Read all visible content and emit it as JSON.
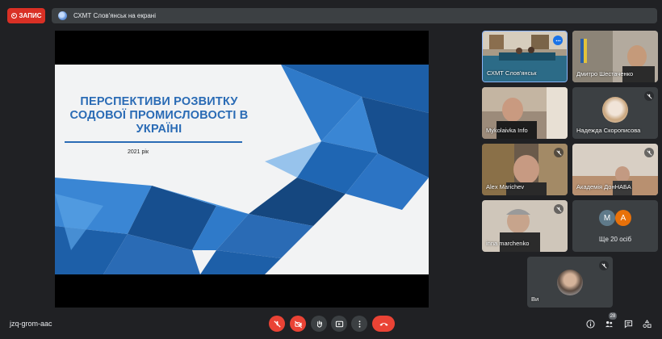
{
  "recording": {
    "label": "ЗАПИС"
  },
  "pinned": {
    "name": "СХМТ Слов'янськ на екрані"
  },
  "slide": {
    "title_line1": "ПЕРСПЕКТИВИ РОЗВИТКУ",
    "title_line2": "СОДОВОЇ ПРОМИСЛОВОСТІ В",
    "title_line3": "УКРАЇНІ",
    "year": "2021 рік",
    "accent_color": "#2a6bb5"
  },
  "participants": [
    {
      "name": "СХМТ Слов'янськ",
      "muted": false,
      "icon": "more-options-icon"
    },
    {
      "name": "Дмитро Шестаченко",
      "muted": false
    },
    {
      "name": "Mykolaivka Info",
      "muted": false
    },
    {
      "name": "Надежда Скорописова",
      "muted": true,
      "icon": "mic-off-icon"
    },
    {
      "name": "Alex Marichev",
      "muted": true,
      "icon": "mic-off-icon"
    },
    {
      "name": "Академія ДонНАБА",
      "muted": true,
      "icon": "mic-off-icon"
    },
    {
      "name": "inna marchenko",
      "muted": true,
      "icon": "mic-off-icon"
    },
    {
      "name": "Ви",
      "muted": true,
      "icon": "mic-off-icon"
    }
  ],
  "more": {
    "initial1": "M",
    "initial2": "A",
    "label": "Ще 20 осіб",
    "color1": "#5f7a8a",
    "color2": "#e8710a"
  },
  "footer": {
    "meeting_code": "jzq-grom-aac",
    "participant_count": "28",
    "hangup_color": "#ea4335"
  }
}
